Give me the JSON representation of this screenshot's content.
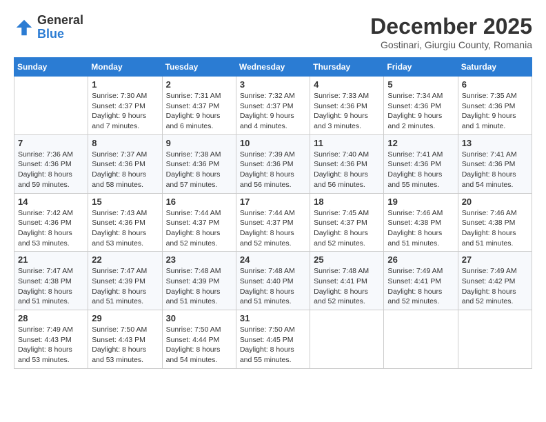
{
  "header": {
    "logo_general": "General",
    "logo_blue": "Blue",
    "month_title": "December 2025",
    "subtitle": "Gostinari, Giurgiu County, Romania"
  },
  "weekdays": [
    "Sunday",
    "Monday",
    "Tuesday",
    "Wednesday",
    "Thursday",
    "Friday",
    "Saturday"
  ],
  "weeks": [
    [
      {
        "day": "",
        "sunrise": "",
        "sunset": "",
        "daylight": ""
      },
      {
        "day": "1",
        "sunrise": "Sunrise: 7:30 AM",
        "sunset": "Sunset: 4:37 PM",
        "daylight": "Daylight: 9 hours and 7 minutes."
      },
      {
        "day": "2",
        "sunrise": "Sunrise: 7:31 AM",
        "sunset": "Sunset: 4:37 PM",
        "daylight": "Daylight: 9 hours and 6 minutes."
      },
      {
        "day": "3",
        "sunrise": "Sunrise: 7:32 AM",
        "sunset": "Sunset: 4:37 PM",
        "daylight": "Daylight: 9 hours and 4 minutes."
      },
      {
        "day": "4",
        "sunrise": "Sunrise: 7:33 AM",
        "sunset": "Sunset: 4:36 PM",
        "daylight": "Daylight: 9 hours and 3 minutes."
      },
      {
        "day": "5",
        "sunrise": "Sunrise: 7:34 AM",
        "sunset": "Sunset: 4:36 PM",
        "daylight": "Daylight: 9 hours and 2 minutes."
      },
      {
        "day": "6",
        "sunrise": "Sunrise: 7:35 AM",
        "sunset": "Sunset: 4:36 PM",
        "daylight": "Daylight: 9 hours and 1 minute."
      }
    ],
    [
      {
        "day": "7",
        "sunrise": "Sunrise: 7:36 AM",
        "sunset": "Sunset: 4:36 PM",
        "daylight": "Daylight: 8 hours and 59 minutes."
      },
      {
        "day": "8",
        "sunrise": "Sunrise: 7:37 AM",
        "sunset": "Sunset: 4:36 PM",
        "daylight": "Daylight: 8 hours and 58 minutes."
      },
      {
        "day": "9",
        "sunrise": "Sunrise: 7:38 AM",
        "sunset": "Sunset: 4:36 PM",
        "daylight": "Daylight: 8 hours and 57 minutes."
      },
      {
        "day": "10",
        "sunrise": "Sunrise: 7:39 AM",
        "sunset": "Sunset: 4:36 PM",
        "daylight": "Daylight: 8 hours and 56 minutes."
      },
      {
        "day": "11",
        "sunrise": "Sunrise: 7:40 AM",
        "sunset": "Sunset: 4:36 PM",
        "daylight": "Daylight: 8 hours and 56 minutes."
      },
      {
        "day": "12",
        "sunrise": "Sunrise: 7:41 AM",
        "sunset": "Sunset: 4:36 PM",
        "daylight": "Daylight: 8 hours and 55 minutes."
      },
      {
        "day": "13",
        "sunrise": "Sunrise: 7:41 AM",
        "sunset": "Sunset: 4:36 PM",
        "daylight": "Daylight: 8 hours and 54 minutes."
      }
    ],
    [
      {
        "day": "14",
        "sunrise": "Sunrise: 7:42 AM",
        "sunset": "Sunset: 4:36 PM",
        "daylight": "Daylight: 8 hours and 53 minutes."
      },
      {
        "day": "15",
        "sunrise": "Sunrise: 7:43 AM",
        "sunset": "Sunset: 4:36 PM",
        "daylight": "Daylight: 8 hours and 53 minutes."
      },
      {
        "day": "16",
        "sunrise": "Sunrise: 7:44 AM",
        "sunset": "Sunset: 4:37 PM",
        "daylight": "Daylight: 8 hours and 52 minutes."
      },
      {
        "day": "17",
        "sunrise": "Sunrise: 7:44 AM",
        "sunset": "Sunset: 4:37 PM",
        "daylight": "Daylight: 8 hours and 52 minutes."
      },
      {
        "day": "18",
        "sunrise": "Sunrise: 7:45 AM",
        "sunset": "Sunset: 4:37 PM",
        "daylight": "Daylight: 8 hours and 52 minutes."
      },
      {
        "day": "19",
        "sunrise": "Sunrise: 7:46 AM",
        "sunset": "Sunset: 4:38 PM",
        "daylight": "Daylight: 8 hours and 51 minutes."
      },
      {
        "day": "20",
        "sunrise": "Sunrise: 7:46 AM",
        "sunset": "Sunset: 4:38 PM",
        "daylight": "Daylight: 8 hours and 51 minutes."
      }
    ],
    [
      {
        "day": "21",
        "sunrise": "Sunrise: 7:47 AM",
        "sunset": "Sunset: 4:38 PM",
        "daylight": "Daylight: 8 hours and 51 minutes."
      },
      {
        "day": "22",
        "sunrise": "Sunrise: 7:47 AM",
        "sunset": "Sunset: 4:39 PM",
        "daylight": "Daylight: 8 hours and 51 minutes."
      },
      {
        "day": "23",
        "sunrise": "Sunrise: 7:48 AM",
        "sunset": "Sunset: 4:39 PM",
        "daylight": "Daylight: 8 hours and 51 minutes."
      },
      {
        "day": "24",
        "sunrise": "Sunrise: 7:48 AM",
        "sunset": "Sunset: 4:40 PM",
        "daylight": "Daylight: 8 hours and 51 minutes."
      },
      {
        "day": "25",
        "sunrise": "Sunrise: 7:48 AM",
        "sunset": "Sunset: 4:41 PM",
        "daylight": "Daylight: 8 hours and 52 minutes."
      },
      {
        "day": "26",
        "sunrise": "Sunrise: 7:49 AM",
        "sunset": "Sunset: 4:41 PM",
        "daylight": "Daylight: 8 hours and 52 minutes."
      },
      {
        "day": "27",
        "sunrise": "Sunrise: 7:49 AM",
        "sunset": "Sunset: 4:42 PM",
        "daylight": "Daylight: 8 hours and 52 minutes."
      }
    ],
    [
      {
        "day": "28",
        "sunrise": "Sunrise: 7:49 AM",
        "sunset": "Sunset: 4:43 PM",
        "daylight": "Daylight: 8 hours and 53 minutes."
      },
      {
        "day": "29",
        "sunrise": "Sunrise: 7:50 AM",
        "sunset": "Sunset: 4:43 PM",
        "daylight": "Daylight: 8 hours and 53 minutes."
      },
      {
        "day": "30",
        "sunrise": "Sunrise: 7:50 AM",
        "sunset": "Sunset: 4:44 PM",
        "daylight": "Daylight: 8 hours and 54 minutes."
      },
      {
        "day": "31",
        "sunrise": "Sunrise: 7:50 AM",
        "sunset": "Sunset: 4:45 PM",
        "daylight": "Daylight: 8 hours and 55 minutes."
      },
      {
        "day": "",
        "sunrise": "",
        "sunset": "",
        "daylight": ""
      },
      {
        "day": "",
        "sunrise": "",
        "sunset": "",
        "daylight": ""
      },
      {
        "day": "",
        "sunrise": "",
        "sunset": "",
        "daylight": ""
      }
    ]
  ]
}
